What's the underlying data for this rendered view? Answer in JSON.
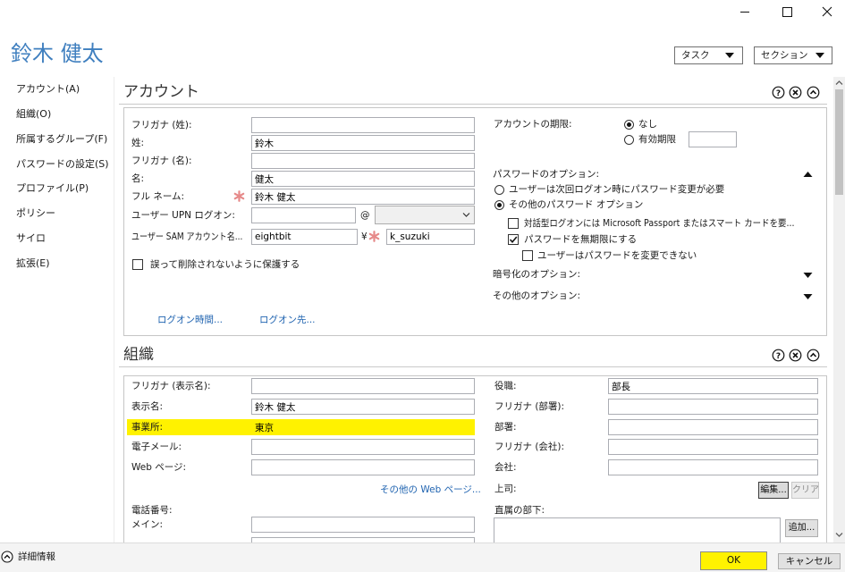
{
  "header": {
    "title": "鈴木 健太",
    "tasks": "タスク",
    "sections": "セクション"
  },
  "nav": {
    "items": [
      "アカウント(A)",
      "組織(O)",
      "所属するグループ(F)",
      "パスワードの設定(S)",
      "プロファイル(P)",
      "ポリシー",
      "サイロ",
      "拡張(E)"
    ]
  },
  "account": {
    "title": "アカウント",
    "furigana_last": {
      "label": "フリガナ (姓):",
      "value": ""
    },
    "last_name": {
      "label": "姓:",
      "value": "鈴木"
    },
    "furigana_first": {
      "label": "フリガナ (名):",
      "value": ""
    },
    "first_name": {
      "label": "名:",
      "value": "健太"
    },
    "full_name": {
      "label": "フル ネーム:",
      "value": "鈴木 健太"
    },
    "upn": {
      "label": "ユーザー UPN ログオン:",
      "value": "",
      "at": "@",
      "domain": ""
    },
    "sam": {
      "label": "ユーザー SAM アカウント名...",
      "domain": "eightbit",
      "separator": "¥",
      "value": "k_suzuki"
    },
    "protect": {
      "label": "誤って削除されないように保護する",
      "checked": false
    },
    "logon_hours": "ログオン時間...",
    "logon_to": "ログオン先...",
    "expiry": {
      "label": "アカウントの期限:",
      "options": [
        {
          "label": "なし",
          "checked": true
        },
        {
          "label": "有効期限",
          "checked": false
        }
      ],
      "date": ""
    },
    "password_options": {
      "label": "パスワードのオプション:",
      "radios": [
        {
          "label": "ユーザーは次回ログオン時にパスワード変更が必要",
          "checked": false
        },
        {
          "label": "その他のパスワード オプション",
          "checked": true
        }
      ],
      "smartcard": {
        "label": "対話型ログオンには Microsoft Passport またはスマート カードを要...",
        "checked": false
      },
      "never_expires": {
        "label": "パスワードを無期限にする",
        "checked": true
      },
      "cannot_change": {
        "label": "ユーザーはパスワードを変更できない",
        "checked": false
      }
    },
    "encryption": "暗号化のオプション:",
    "other_options": "その他のオプション:"
  },
  "organization": {
    "title": "組織",
    "furigana_display": {
      "label": "フリガナ (表示名):",
      "value": ""
    },
    "display_name": {
      "label": "表示名:",
      "value": "鈴木 健太"
    },
    "office": {
      "label": "事業所:",
      "value": "東京"
    },
    "email": {
      "label": "電子メール:",
      "value": ""
    },
    "web_page": {
      "label": "Web ページ:",
      "value": ""
    },
    "other_web_pages": "その他の Web ページ...",
    "phone_heading": "電話番号:",
    "main_phone": {
      "label": "メイン:",
      "value": ""
    },
    "job_title": {
      "label": "役職:",
      "value": "部長"
    },
    "furigana_department": {
      "label": "フリガナ (部署):",
      "value": ""
    },
    "department": {
      "label": "部署:",
      "value": ""
    },
    "furigana_company": {
      "label": "フリガナ (会社):",
      "value": ""
    },
    "company": {
      "label": "会社:",
      "value": ""
    },
    "manager": {
      "label": "上司:",
      "edit": "編集...",
      "clear": "クリア"
    },
    "direct_reports": {
      "label": "直属の部下:",
      "add": "追加..."
    }
  },
  "footer": {
    "more_info": "詳細情報",
    "ok": "OK",
    "cancel": "キャンセル"
  },
  "icons": {
    "window": [
      "minimize-icon",
      "maximize-icon",
      "close-window-icon"
    ],
    "section": [
      "help-icon",
      "remove-section-icon",
      "collapse-section-icon"
    ],
    "misc": [
      "chevron-down-icon",
      "required-asterisk-icon",
      "collapse-up-icon",
      "expand-down-icon",
      "scroll-up-icon",
      "scroll-down-icon",
      "expand-details-icon",
      "checkmark-icon"
    ]
  },
  "colors": {
    "title": "#3f7fbf",
    "link": "#1f63b0",
    "highlight": "#fff200",
    "required": "#e68a8a"
  }
}
